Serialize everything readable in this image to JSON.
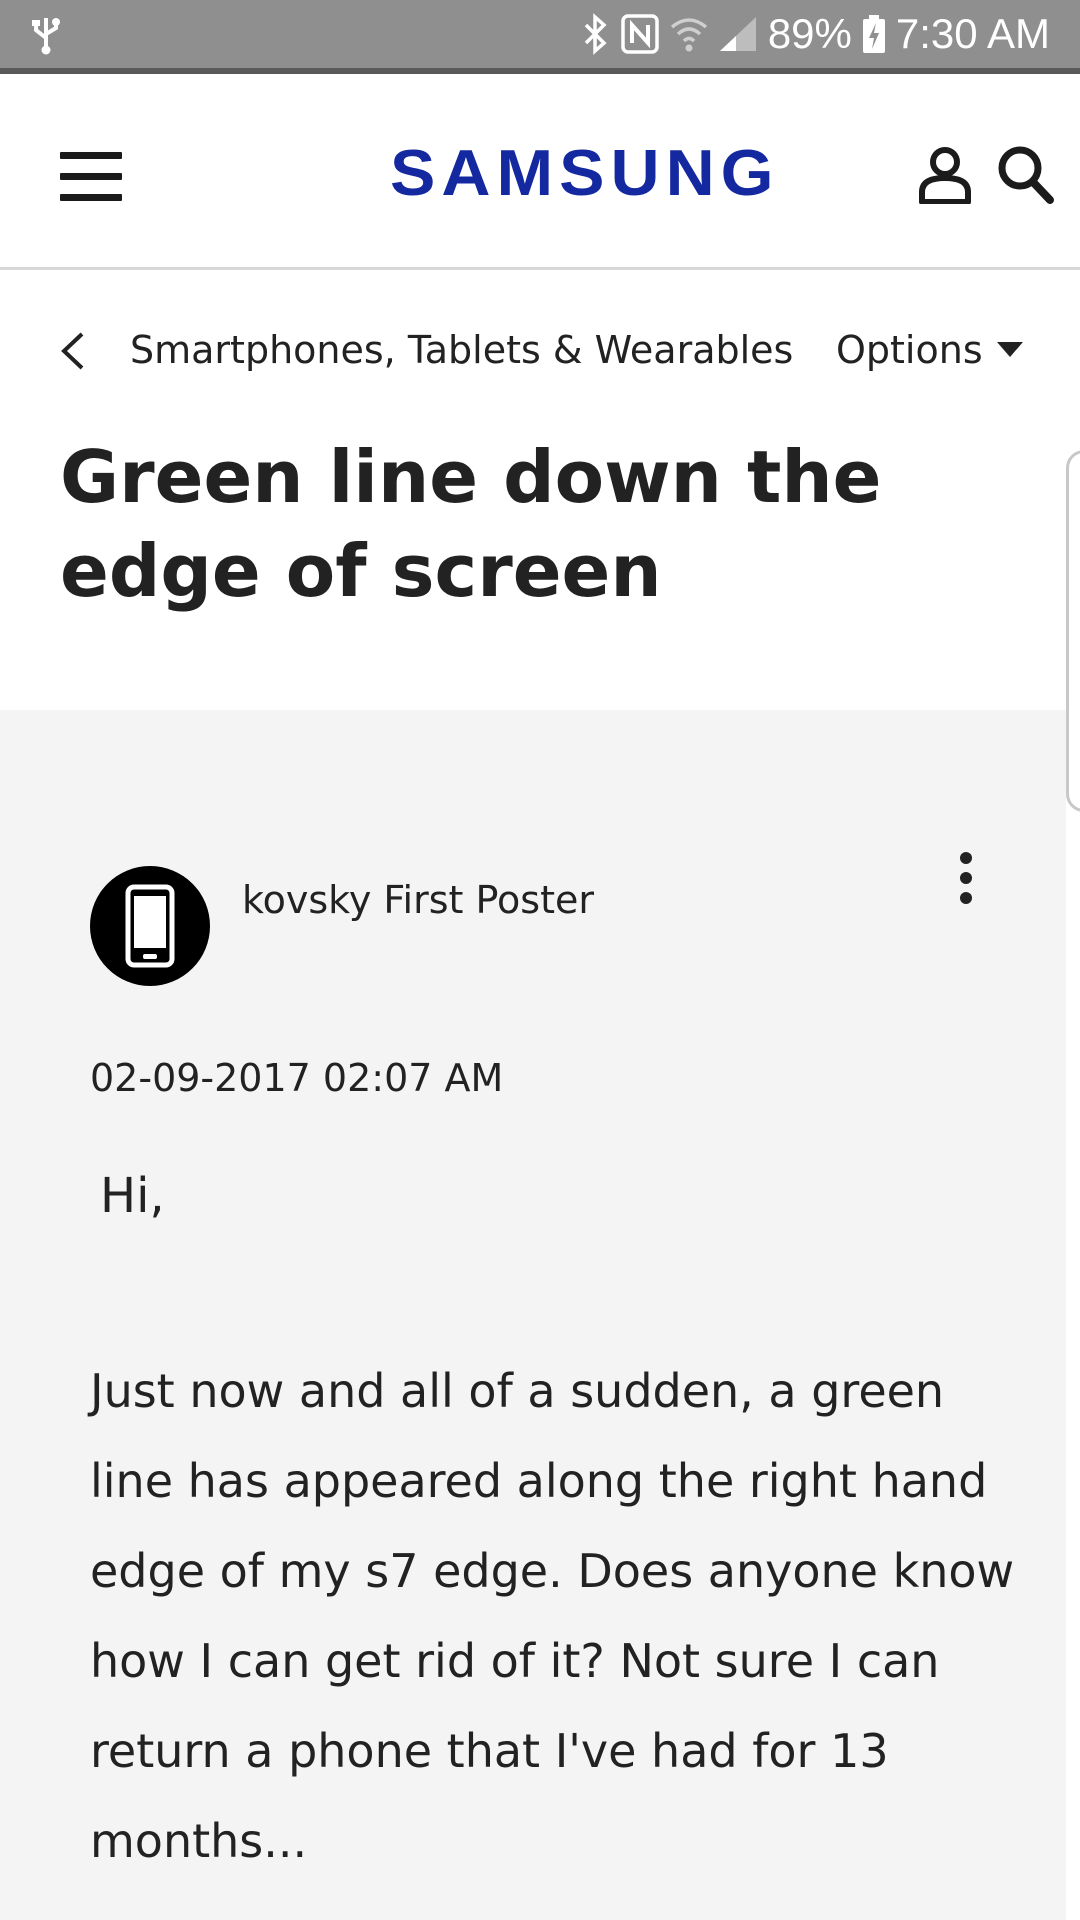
{
  "status_bar": {
    "battery": "89%",
    "time": "7:30 AM"
  },
  "header": {
    "logo_text": "SAMSUNG",
    "brand_color": "#1428a0"
  },
  "breadcrumb": {
    "label": "Smartphones, Tablets & Wearables",
    "options_label": "Options"
  },
  "page": {
    "title": "Green line down the edge of screen"
  },
  "post": {
    "author": "kovsky",
    "rank": "First Poster",
    "date": "02-09-2017 02:07 AM",
    "greeting": "Hi,",
    "body": "Just now and all of a sudden, a green line has appeared along the right hand edge of my s7 edge. Does anyone know how I can get rid of it? Not sure I can return a phone that I've had for 13 months..."
  }
}
